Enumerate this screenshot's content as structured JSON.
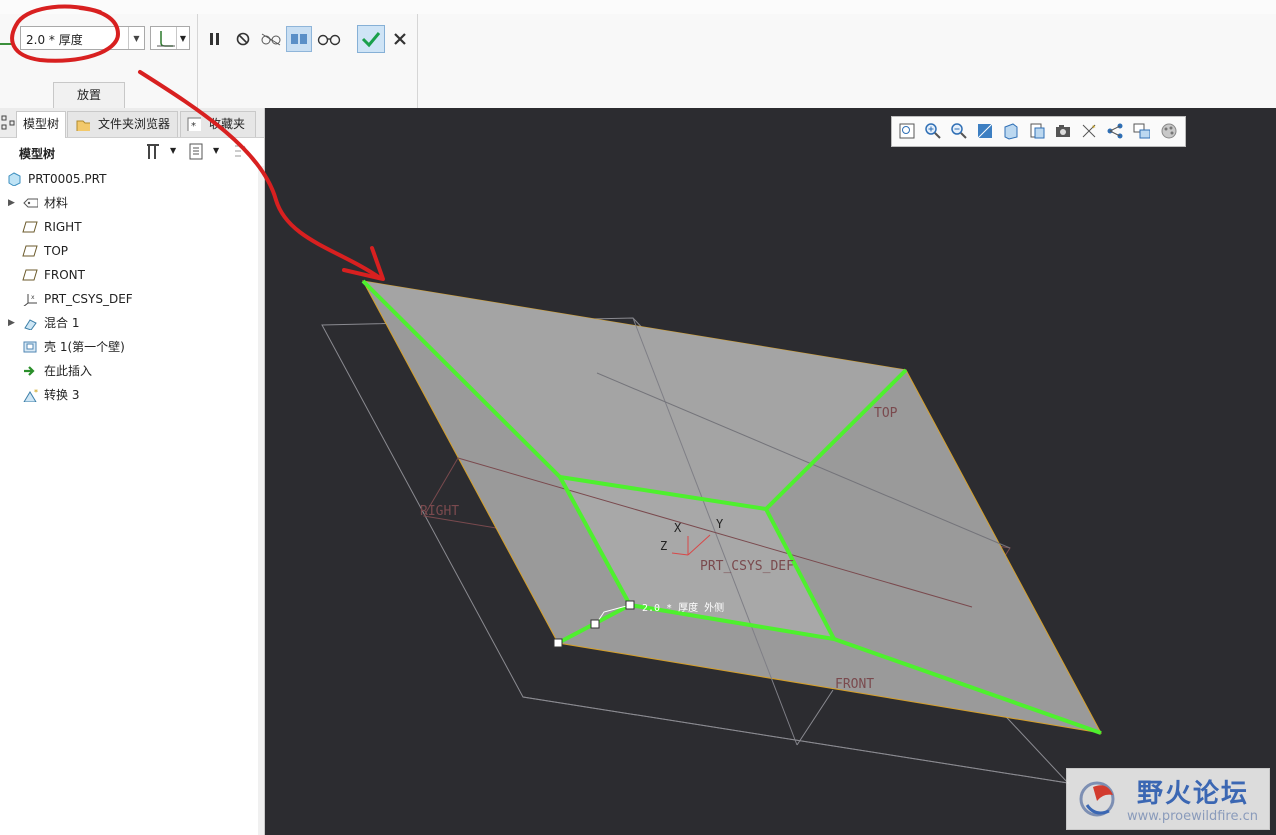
{
  "ribbon": {
    "thickness_value": "2.0 * 厚度",
    "placement_tab": "放置"
  },
  "panel": {
    "tabs": [
      {
        "label": "模型树"
      },
      {
        "label": "文件夹浏览器"
      },
      {
        "label": "收藏夹"
      }
    ],
    "tree_title": "模型树",
    "tree_items": [
      {
        "label": "PRT0005.PRT",
        "icon": "part-icon"
      },
      {
        "label": "材料",
        "icon": "material-icon",
        "expandable": true
      },
      {
        "label": "RIGHT",
        "icon": "datum-plane-icon"
      },
      {
        "label": "TOP",
        "icon": "datum-plane-icon"
      },
      {
        "label": "FRONT",
        "icon": "datum-plane-icon"
      },
      {
        "label": "PRT_CSYS_DEF",
        "icon": "csys-icon"
      },
      {
        "label": "混合 1",
        "icon": "blend-icon",
        "expandable": true
      },
      {
        "label": "壳 1(第一个壁)",
        "icon": "shell-icon"
      },
      {
        "label": "在此插入",
        "icon": "insert-arrow-icon"
      },
      {
        "label": "转换 3",
        "icon": "convert-icon"
      }
    ]
  },
  "viewport": {
    "datum_labels": {
      "top": "TOP",
      "right": "RIGHT",
      "front": "FRONT",
      "csys": "PRT_CSYS_DEF"
    },
    "axis_labels": {
      "x": "X",
      "y": "Y",
      "z": "Z"
    },
    "dimension_label": "2.0 * 厚度 外侧",
    "colors": {
      "background": "#2c2c30",
      "surface": "#9a9a9a",
      "edge_highlight": "#4ef02e",
      "datum": "#7a4a4e"
    }
  },
  "watermark": {
    "title": "野火论坛",
    "url": "www.proewildfire.cn"
  }
}
